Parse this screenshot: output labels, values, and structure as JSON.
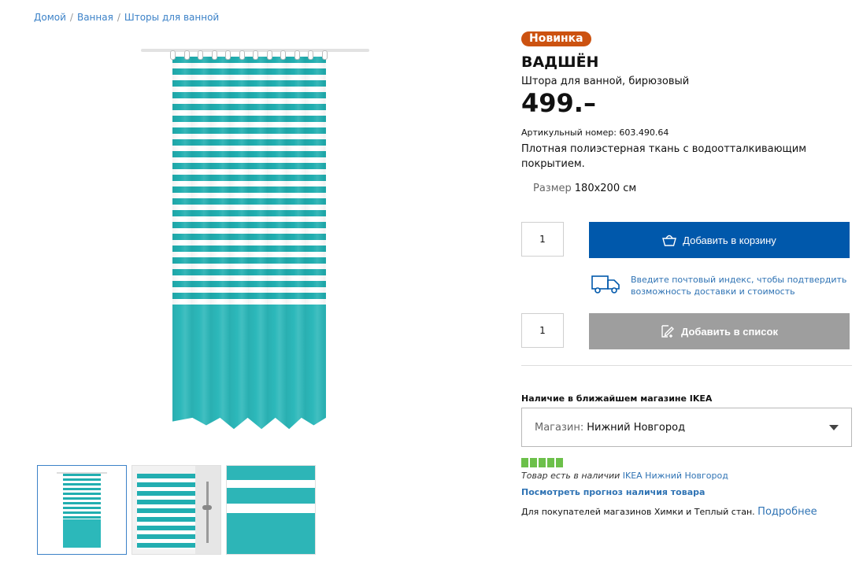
{
  "breadcrumb": [
    {
      "label": "Домой"
    },
    {
      "label": "Ванная"
    },
    {
      "label": "Шторы для ванной"
    }
  ],
  "colors": {
    "accent_blue": "#0058ab",
    "badge_orange": "#cc5210",
    "stock_green": "#6cc04a",
    "curtain_turquoise": "#2cb8ba"
  },
  "product": {
    "badge": "Новинка",
    "name": "ВАДШЁН",
    "type": "Штора для ванной, бирюзовый",
    "price": "499.–",
    "article_number": "Артикульный номер: 603.490.64",
    "description": "Плотная полиэстерная ткань с водоотталкивающим покрытием.",
    "size_label": "Размер",
    "size_value": "180x200 см"
  },
  "cart": {
    "quantity": "1",
    "add_to_cart_label": "Добавить в корзину",
    "cart_icon": "shopping-bag-icon"
  },
  "delivery": {
    "icon": "delivery-truck-icon",
    "text": "Введите почтовый индекс, чтобы подтвердить возможность доставки и стоимость"
  },
  "shopping_list": {
    "quantity": "1",
    "add_to_list_label": "Добавить в список",
    "list_icon": "edit-list-icon"
  },
  "availability": {
    "heading": "Наличие в ближайшем магазине IKEA",
    "store_label": "Магазин:",
    "store_value": "Нижний Новгород",
    "stock_level": 5,
    "stock_text": "Товар есть в наличии",
    "stock_store": "IKEA Нижний Новгород",
    "forecast_link": "Посмотреть прогноз наличия товара",
    "buyers_note": "Для покупателей магазинов Химки и Теплый стан.",
    "more_link": "Подробнее"
  },
  "gallery": {
    "selected_index": 0,
    "thumbnails": [
      "curtain-front",
      "curtain-in-bathroom",
      "fabric-closeup"
    ]
  }
}
